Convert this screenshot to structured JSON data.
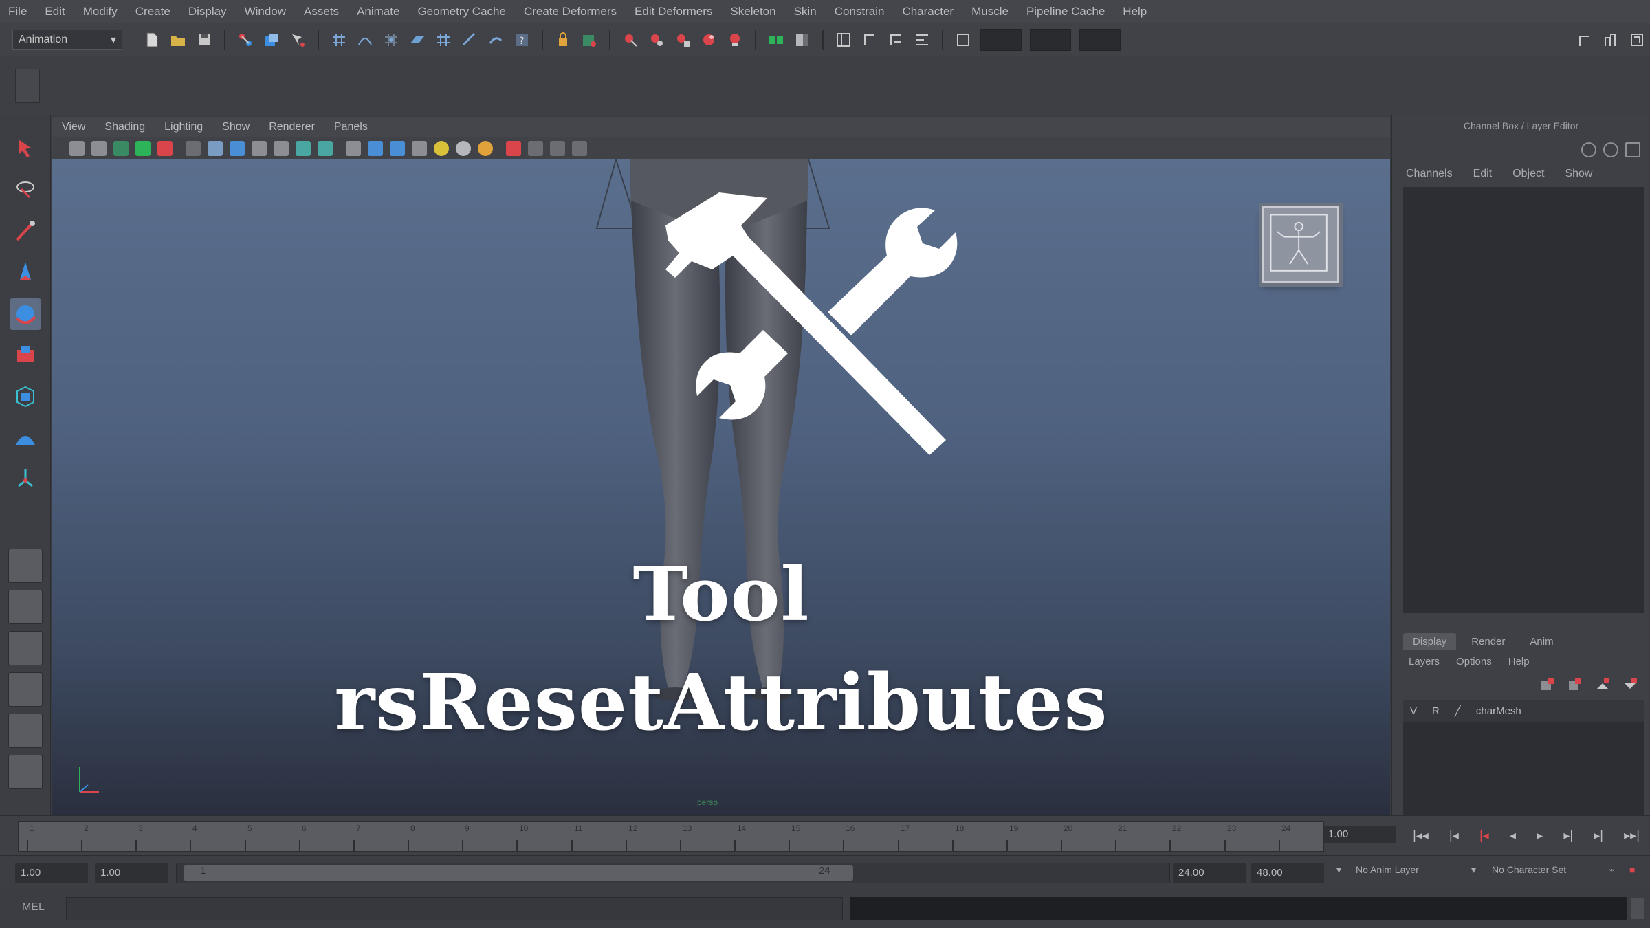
{
  "menubar": {
    "items": [
      "File",
      "Edit",
      "Modify",
      "Create",
      "Display",
      "Window",
      "Assets",
      "Animate",
      "Geometry Cache",
      "Create Deformers",
      "Edit Deformers",
      "Skeleton",
      "Skin",
      "Constrain",
      "Character",
      "Muscle",
      "Pipeline Cache",
      "Help"
    ]
  },
  "statusline": {
    "mode": "Animation"
  },
  "panel": {
    "menu": [
      "View",
      "Shading",
      "Lighting",
      "Show",
      "Renderer",
      "Panels"
    ],
    "camera_label": "persp"
  },
  "overlay": {
    "line1": "Tool",
    "line2": "rsResetAttributes"
  },
  "channelbox": {
    "header": "Channel Box / Layer Editor",
    "menu": [
      "Channels",
      "Edit",
      "Object",
      "Show"
    ],
    "layer_tabs": [
      "Display",
      "Render",
      "Anim"
    ],
    "layer_menu": [
      "Layers",
      "Options",
      "Help"
    ],
    "layers": [
      {
        "v": "V",
        "r": "R",
        "name": "charMesh"
      }
    ]
  },
  "timeslider": {
    "ticks": [
      "1",
      "2",
      "3",
      "4",
      "5",
      "6",
      "7",
      "8",
      "9",
      "10",
      "11",
      "12",
      "13",
      "14",
      "15",
      "16",
      "17",
      "18",
      "19",
      "20",
      "21",
      "22",
      "23",
      "24"
    ],
    "current_frame": "1.00"
  },
  "rangeslider": {
    "start_time": "1.00",
    "playback_start": "1.00",
    "range_low": "1",
    "range_high": "24",
    "playback_end": "24.00",
    "end_time": "48.00",
    "anim_layer": "No Anim Layer",
    "character_set": "No Character Set"
  },
  "cmdline": {
    "label": "MEL"
  },
  "colors": {
    "accent_red": "#d9454b",
    "accent_blue": "#3b8ee0",
    "green": "#2db35a"
  }
}
